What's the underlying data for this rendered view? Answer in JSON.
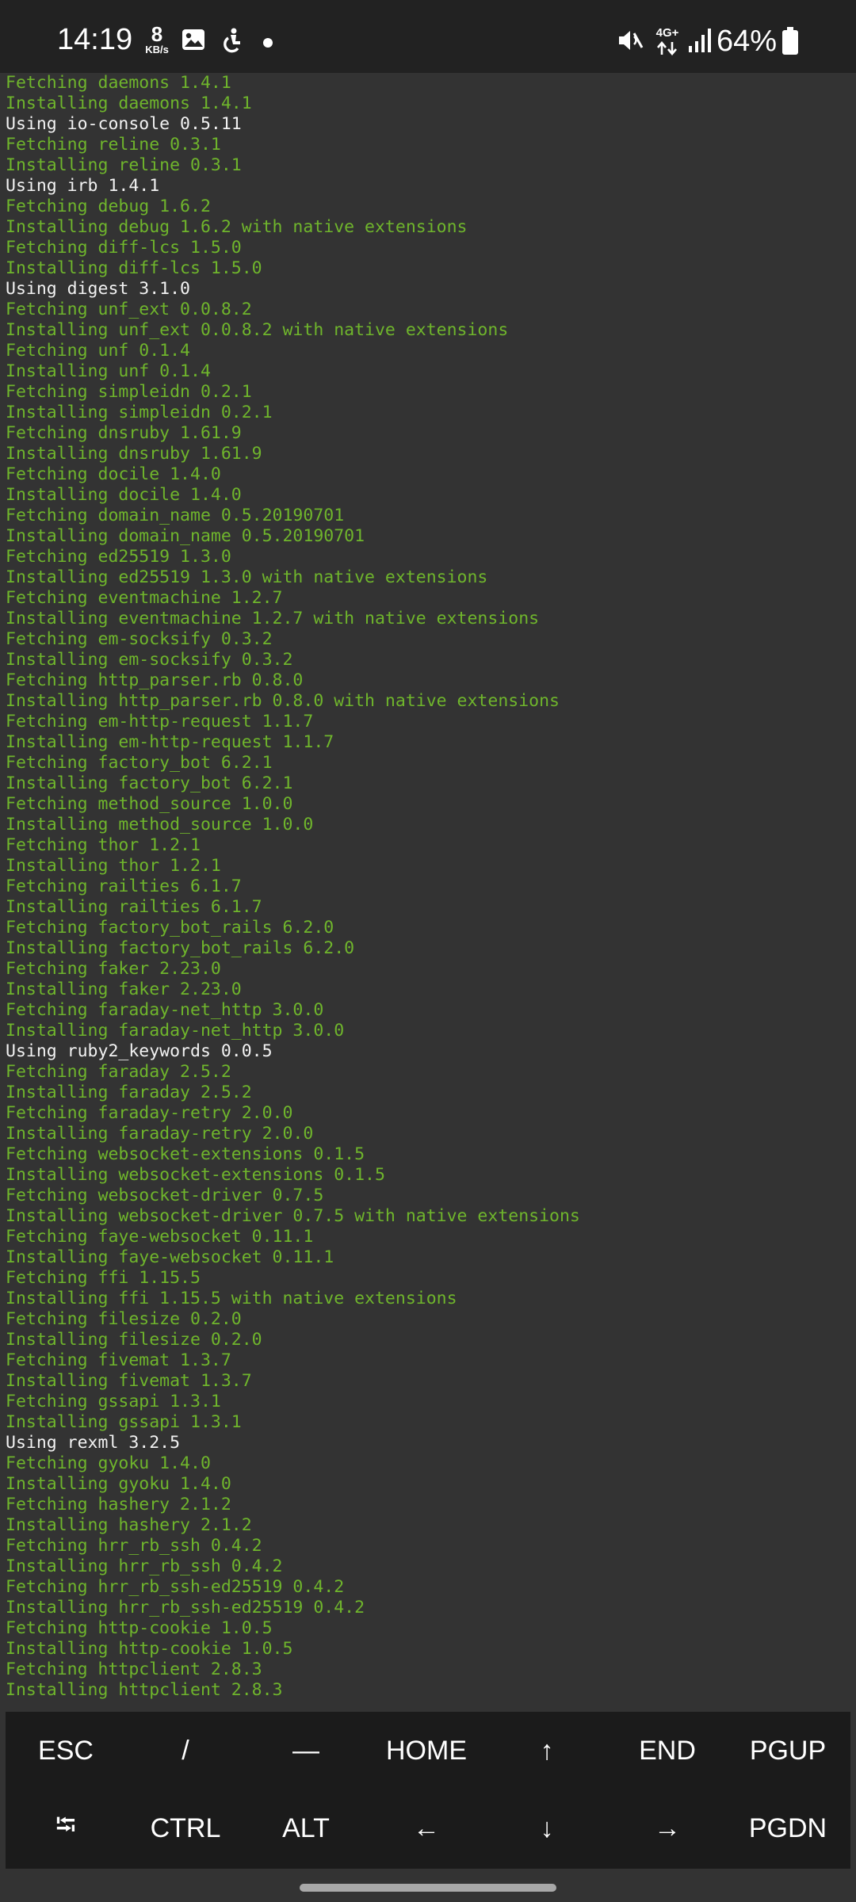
{
  "status_bar": {
    "time": "14:19",
    "net_speed_value": "8",
    "net_speed_unit": "KB/s",
    "network_type": "4G+",
    "battery_percent": "64%",
    "icons": [
      "image-icon",
      "accessibility-icon",
      "notification-dot",
      "mute-icon",
      "data-arrows-icon",
      "signal-icon",
      "battery-icon"
    ]
  },
  "terminal": {
    "colors": {
      "green": "#6fb52c",
      "white": "#f2f2f2",
      "background": "#333333"
    },
    "lines": [
      {
        "text": "Fetching daemons 1.4.1",
        "color": "green"
      },
      {
        "text": "Installing daemons 1.4.1",
        "color": "green"
      },
      {
        "text": "Using io-console 0.5.11",
        "color": "white"
      },
      {
        "text": "Fetching reline 0.3.1",
        "color": "green"
      },
      {
        "text": "Installing reline 0.3.1",
        "color": "green"
      },
      {
        "text": "Using irb 1.4.1",
        "color": "white"
      },
      {
        "text": "Fetching debug 1.6.2",
        "color": "green"
      },
      {
        "text": "Installing debug 1.6.2 with native extensions",
        "color": "green"
      },
      {
        "text": "Fetching diff-lcs 1.5.0",
        "color": "green"
      },
      {
        "text": "Installing diff-lcs 1.5.0",
        "color": "green"
      },
      {
        "text": "Using digest 3.1.0",
        "color": "white"
      },
      {
        "text": "Fetching unf_ext 0.0.8.2",
        "color": "green"
      },
      {
        "text": "Installing unf_ext 0.0.8.2 with native extensions",
        "color": "green"
      },
      {
        "text": "Fetching unf 0.1.4",
        "color": "green"
      },
      {
        "text": "Installing unf 0.1.4",
        "color": "green"
      },
      {
        "text": "Fetching simpleidn 0.2.1",
        "color": "green"
      },
      {
        "text": "Installing simpleidn 0.2.1",
        "color": "green"
      },
      {
        "text": "Fetching dnsruby 1.61.9",
        "color": "green"
      },
      {
        "text": "Installing dnsruby 1.61.9",
        "color": "green"
      },
      {
        "text": "Fetching docile 1.4.0",
        "color": "green"
      },
      {
        "text": "Installing docile 1.4.0",
        "color": "green"
      },
      {
        "text": "Fetching domain_name 0.5.20190701",
        "color": "green"
      },
      {
        "text": "Installing domain_name 0.5.20190701",
        "color": "green"
      },
      {
        "text": "Fetching ed25519 1.3.0",
        "color": "green"
      },
      {
        "text": "Installing ed25519 1.3.0 with native extensions",
        "color": "green"
      },
      {
        "text": "Fetching eventmachine 1.2.7",
        "color": "green"
      },
      {
        "text": "Installing eventmachine 1.2.7 with native extensions",
        "color": "green"
      },
      {
        "text": "Fetching em-socksify 0.3.2",
        "color": "green"
      },
      {
        "text": "Installing em-socksify 0.3.2",
        "color": "green"
      },
      {
        "text": "Fetching http_parser.rb 0.8.0",
        "color": "green"
      },
      {
        "text": "Installing http_parser.rb 0.8.0 with native extensions",
        "color": "green"
      },
      {
        "text": "Fetching em-http-request 1.1.7",
        "color": "green"
      },
      {
        "text": "Installing em-http-request 1.1.7",
        "color": "green"
      },
      {
        "text": "Fetching factory_bot 6.2.1",
        "color": "green"
      },
      {
        "text": "Installing factory_bot 6.2.1",
        "color": "green"
      },
      {
        "text": "Fetching method_source 1.0.0",
        "color": "green"
      },
      {
        "text": "Installing method_source 1.0.0",
        "color": "green"
      },
      {
        "text": "Fetching thor 1.2.1",
        "color": "green"
      },
      {
        "text": "Installing thor 1.2.1",
        "color": "green"
      },
      {
        "text": "Fetching railties 6.1.7",
        "color": "green"
      },
      {
        "text": "Installing railties 6.1.7",
        "color": "green"
      },
      {
        "text": "Fetching factory_bot_rails 6.2.0",
        "color": "green"
      },
      {
        "text": "Installing factory_bot_rails 6.2.0",
        "color": "green"
      },
      {
        "text": "Fetching faker 2.23.0",
        "color": "green"
      },
      {
        "text": "Installing faker 2.23.0",
        "color": "green"
      },
      {
        "text": "Fetching faraday-net_http 3.0.0",
        "color": "green"
      },
      {
        "text": "Installing faraday-net_http 3.0.0",
        "color": "green"
      },
      {
        "text": "Using ruby2_keywords 0.0.5",
        "color": "white"
      },
      {
        "text": "Fetching faraday 2.5.2",
        "color": "green"
      },
      {
        "text": "Installing faraday 2.5.2",
        "color": "green"
      },
      {
        "text": "Fetching faraday-retry 2.0.0",
        "color": "green"
      },
      {
        "text": "Installing faraday-retry 2.0.0",
        "color": "green"
      },
      {
        "text": "Fetching websocket-extensions 0.1.5",
        "color": "green"
      },
      {
        "text": "Installing websocket-extensions 0.1.5",
        "color": "green"
      },
      {
        "text": "Fetching websocket-driver 0.7.5",
        "color": "green"
      },
      {
        "text": "Installing websocket-driver 0.7.5 with native extensions",
        "color": "green"
      },
      {
        "text": "Fetching faye-websocket 0.11.1",
        "color": "green"
      },
      {
        "text": "Installing faye-websocket 0.11.1",
        "color": "green"
      },
      {
        "text": "Fetching ffi 1.15.5",
        "color": "green"
      },
      {
        "text": "Installing ffi 1.15.5 with native extensions",
        "color": "green"
      },
      {
        "text": "Fetching filesize 0.2.0",
        "color": "green"
      },
      {
        "text": "Installing filesize 0.2.0",
        "color": "green"
      },
      {
        "text": "Fetching fivemat 1.3.7",
        "color": "green"
      },
      {
        "text": "Installing fivemat 1.3.7",
        "color": "green"
      },
      {
        "text": "Fetching gssapi 1.3.1",
        "color": "green"
      },
      {
        "text": "Installing gssapi 1.3.1",
        "color": "green"
      },
      {
        "text": "Using rexml 3.2.5",
        "color": "white"
      },
      {
        "text": "Fetching gyoku 1.4.0",
        "color": "green"
      },
      {
        "text": "Installing gyoku 1.4.0",
        "color": "green"
      },
      {
        "text": "Fetching hashery 2.1.2",
        "color": "green"
      },
      {
        "text": "Installing hashery 2.1.2",
        "color": "green"
      },
      {
        "text": "Fetching hrr_rb_ssh 0.4.2",
        "color": "green"
      },
      {
        "text": "Installing hrr_rb_ssh 0.4.2",
        "color": "green"
      },
      {
        "text": "Fetching hrr_rb_ssh-ed25519 0.4.2",
        "color": "green"
      },
      {
        "text": "Installing hrr_rb_ssh-ed25519 0.4.2",
        "color": "green"
      },
      {
        "text": "Fetching http-cookie 1.0.5",
        "color": "green"
      },
      {
        "text": "Installing http-cookie 1.0.5",
        "color": "green"
      },
      {
        "text": "Fetching httpclient 2.8.3",
        "color": "green"
      },
      {
        "text": "Installing httpclient 2.8.3",
        "color": "green"
      }
    ]
  },
  "extra_keys": {
    "row1": [
      {
        "label": "ESC",
        "name": "esc-key"
      },
      {
        "label": "/",
        "name": "slash-key"
      },
      {
        "label": "—",
        "name": "dash-key"
      },
      {
        "label": "HOME",
        "name": "home-key"
      },
      {
        "label": "↑",
        "name": "arrow-up-key"
      },
      {
        "label": "END",
        "name": "end-key"
      },
      {
        "label": "PGUP",
        "name": "pgup-key"
      }
    ],
    "row2": [
      {
        "label": "⭾",
        "name": "tab-key"
      },
      {
        "label": "CTRL",
        "name": "ctrl-key"
      },
      {
        "label": "ALT",
        "name": "alt-key"
      },
      {
        "label": "←",
        "name": "arrow-left-key"
      },
      {
        "label": "↓",
        "name": "arrow-down-key"
      },
      {
        "label": "→",
        "name": "arrow-right-key"
      },
      {
        "label": "PGDN",
        "name": "pgdn-key"
      }
    ]
  }
}
